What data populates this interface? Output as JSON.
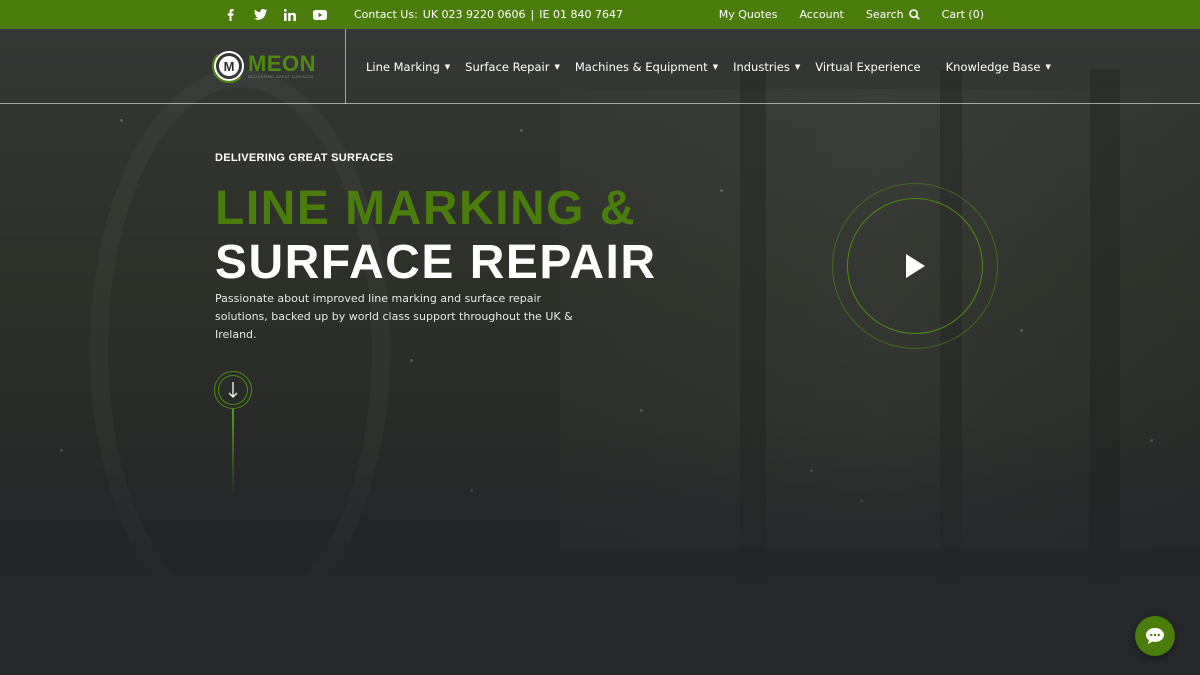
{
  "topbar": {
    "social": [
      "facebook-icon",
      "twitter-icon",
      "linkedin-icon",
      "youtube-icon"
    ],
    "contact_label": "Contact Us:",
    "uk_phone": "UK  023 9220 0606",
    "separator": "|",
    "ie_phone": "IE  01 840 7647",
    "my_quotes": "My Quotes",
    "account": "Account",
    "search": "Search",
    "cart": "Cart (0)"
  },
  "logo": {
    "wordmark": "MEON",
    "badge_letter": "M",
    "tagline": "DELIVERING GREAT SURFACES"
  },
  "nav": {
    "items": [
      {
        "label": "Line Marking",
        "dropdown": true
      },
      {
        "label": "Surface Repair",
        "dropdown": true
      },
      {
        "label": "Machines & Equipment",
        "dropdown": true
      },
      {
        "label": "Industries",
        "dropdown": true
      },
      {
        "label": "Virtual Experience",
        "dropdown": false
      },
      {
        "label": "Knowledge Base",
        "dropdown": true
      }
    ]
  },
  "hero": {
    "kicker": "DELIVERING GREAT SURFACES",
    "title_line1": "LINE MARKING &",
    "title_line2": "SURFACE REPAIR",
    "description": "Passionate about improved line marking and surface repair solutions, backed up by world class support throughout the UK & Ireland."
  },
  "colors": {
    "brand_green": "#4a7d0c",
    "heading_green": "#4a7d0c",
    "background": "#26282a"
  },
  "icons": {
    "search": "search-icon",
    "play": "play-icon",
    "scroll_down": "arrow-down-icon",
    "chat": "chat-icon"
  }
}
